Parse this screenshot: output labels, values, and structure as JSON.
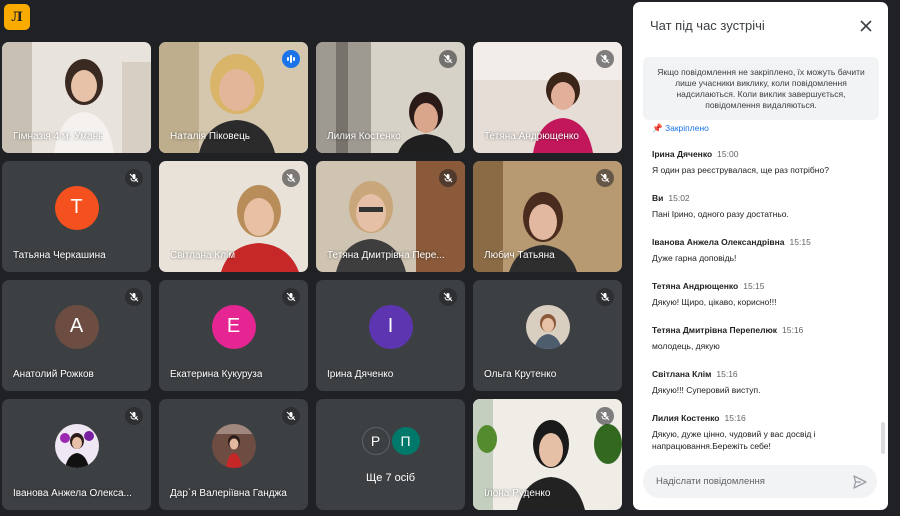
{
  "app": {
    "logo_text": "Л",
    "accent": "#f9ab00"
  },
  "tiles": [
    {
      "name": "Гімназія 4 м. Умань"
    },
    {
      "name": "Наталія Піковець"
    },
    {
      "name": "Лилия Костенко"
    },
    {
      "name": "Тетяна Андрющенко"
    },
    {
      "name": "Татьяна Черкашина",
      "initial": "T",
      "color": "#f4511e"
    },
    {
      "name": "Світлана Клім"
    },
    {
      "name": "Тетяна Дмитрівна Пере..."
    },
    {
      "name": "Любич Татьяна"
    },
    {
      "name": "Анатолий Рожков",
      "initial": "A",
      "color": "#6d4c41"
    },
    {
      "name": "Екатерина Кукуруза",
      "initial": "E",
      "color": "#e52592"
    },
    {
      "name": "Ірина Дяченко",
      "initial": "I",
      "color": "#5e35b1"
    },
    {
      "name": "Ольга Крутенко"
    },
    {
      "name": "Іванова Анжела Олекса..."
    },
    {
      "name": "Дар`я Валеріївна Ганджа"
    },
    {
      "label": "Ще 7 осіб",
      "avatars": [
        {
          "initial": "P",
          "color": "#3c4043"
        },
        {
          "initial": "П",
          "color": "#00796b"
        }
      ]
    },
    {
      "name": "Ілона Руденко"
    }
  ],
  "chat": {
    "title": "Чат під час зустрічі",
    "notice": "Якщо повідомлення не закріплено, їх можуть бачити лише учасники виклику, коли повідомлення надсилаються. Коли виклик завершується, повідомлення видаляються.",
    "pinned_label": "Закріплено",
    "messages": [
      {
        "author": "Ірина Дяченко",
        "time": "15:00",
        "text": "Я один раз реєструвалася, ще раз потрібно?"
      },
      {
        "author": "Ви",
        "time": "15:02",
        "text": "Пані Ірино, одного разу достатньо."
      },
      {
        "author": "Іванова Анжела Олександрівна",
        "time": "15:15",
        "text": "Дуже гарна доповідь!"
      },
      {
        "author": "Тетяна Андрющенко",
        "time": "15:15",
        "text": "Дякую! Щиро, цікаво, корисно!!!"
      },
      {
        "author": "Тетяна Дмитрівна Перепелюк",
        "time": "15:16",
        "text": "молодець, дякую"
      },
      {
        "author": "Світлана Клім",
        "time": "15:16",
        "text": "Дякую!!! Суперовий виступ."
      },
      {
        "author": "Лилия Костенко",
        "time": "15:16",
        "text": "Дякую, дуже цінно, чудовий у вас досвід і напрацювання.Бережіть себе!"
      }
    ],
    "input_placeholder": "Надіслати повідомлення"
  }
}
